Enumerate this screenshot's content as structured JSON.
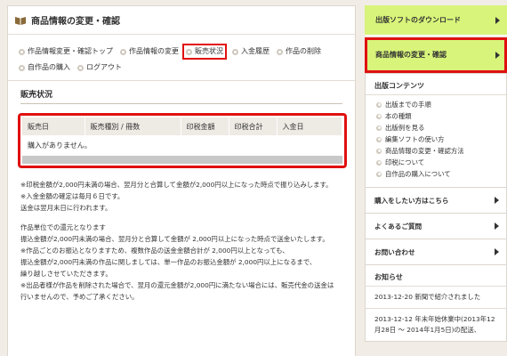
{
  "page": {
    "title": "商品情報の変更・確認",
    "icon": "book-icon"
  },
  "subnav": {
    "row1": [
      {
        "label": "作品情報変更・確認トップ",
        "active": false
      },
      {
        "label": "作品情報の変更",
        "active": false
      },
      {
        "label": "販売状況",
        "active": true
      },
      {
        "label": "入金履歴",
        "active": false
      },
      {
        "label": "作品の削除",
        "active": false
      }
    ],
    "row2": [
      {
        "label": "自作品の購入",
        "active": false
      },
      {
        "label": "ログアウト",
        "active": false
      }
    ]
  },
  "sales": {
    "section_title": "販売状況",
    "columns": [
      "販売日",
      "販売種別 / 冊数",
      "印税金額",
      "印税合計",
      "入金日"
    ],
    "empty_message": "購入がありません。"
  },
  "notes": [
    "※印税金額が2,000円未満の場合、翌月分と合算して金額が2,000円以上になった時点で振り込みします。",
    "※入金金額の確定は毎月６日です。",
    "送金は翌月末日に行われます。",
    "",
    "作品単位での還元となります",
    "振込金額が2,000円未満の場合、翌月分と合算して金額が 2,000円以上になった時点で送金いたします。",
    "※作品ごとのお振込となりますため、複数作品の送金金額合計が 2,000円以上となっても、",
    "振込金額が2,000円未満の作品に関しましては、単一作品のお振込金額が 2,000円以上になるまで、",
    "繰り越しさせていただきます。",
    "※出品者様が作品を削除された場合で、翌月の還元金額が2,000円に満たない場合には、販売代金の送金は",
    "行いませんので、予めご了承ください。"
  ],
  "sidebar": {
    "download_label": "出版ソフトのダウンロード",
    "change_label": "商品情報の変更・確認",
    "contents_head": "出版コンテンツ",
    "contents": [
      "出版までの手順",
      "本の種類",
      "出版例を見る",
      "編集ソフトの使い方",
      "商品情報の変更・確認方法",
      "印税について",
      "自作品の購入について"
    ],
    "buyer_label": "購入をしたい方はこちら",
    "faq_label": "よくあるご質問",
    "contact_label": "お問い合わせ",
    "news_head": "お知らせ",
    "news": [
      "2013-12-20 新聞で紹介されました",
      "2013-12-12 年末年始休業中(2013年12月28日 ～ 2014年1月5日)の配送、"
    ]
  },
  "colors": {
    "highlight_red": "#e01010",
    "sidebar_green": "#d8f47a",
    "background": "#f1ede6"
  }
}
